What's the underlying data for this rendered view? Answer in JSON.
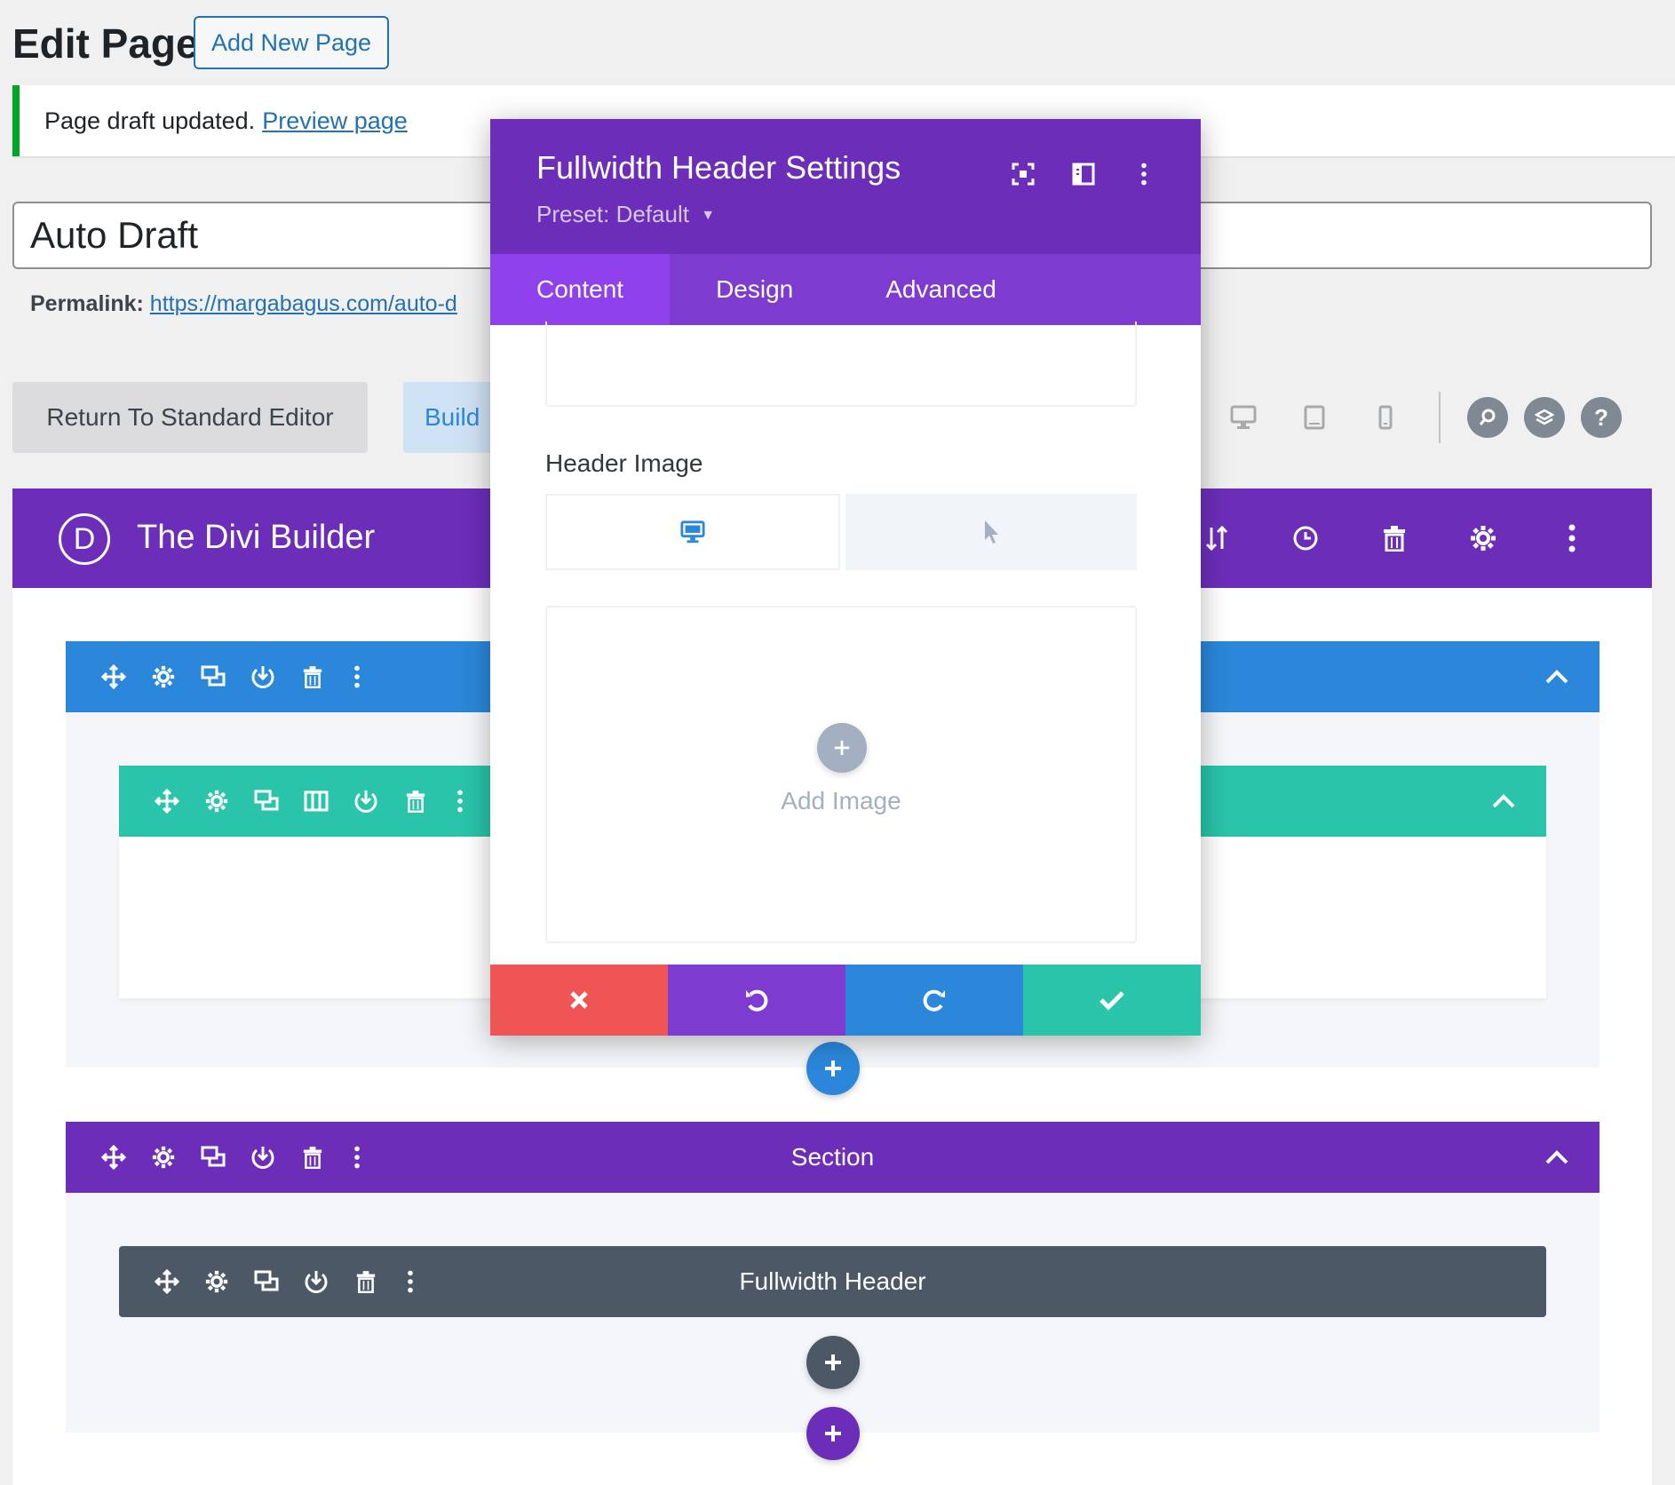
{
  "header": {
    "title": "Edit Page",
    "add_new_label": "Add New Page"
  },
  "notice": {
    "text": "Page draft updated.",
    "link": "Preview page"
  },
  "post": {
    "title": "Auto Draft",
    "permalink_label": "Permalink:",
    "permalink_url": "https://margabagus.com/auto-d"
  },
  "editor": {
    "return_label": "Return To Standard Editor",
    "build_label": "Build",
    "view_icons": [
      "desktop-icon",
      "tablet-icon",
      "phone-icon"
    ],
    "help_icons": [
      "search-icon",
      "layers-icon",
      "help-icon"
    ]
  },
  "builder": {
    "logo_letter": "D",
    "title": "The Divi Builder",
    "actions": [
      "sort-icon",
      "history-icon",
      "trash-icon",
      "gear-icon",
      "more-icon"
    ]
  },
  "modal": {
    "title": "Fullwidth Header Settings",
    "preset": "Preset: Default",
    "tabs": [
      "Content",
      "Design",
      "Advanced"
    ],
    "active_tab": "Content",
    "header_image_label": "Header Image",
    "add_image_label": "Add Image",
    "footer_buttons": [
      "cancel-icon",
      "undo-icon",
      "redo-icon",
      "save-icon"
    ]
  },
  "layout": {
    "section2_label": "Section",
    "module_label": "Fullwidth Header"
  },
  "colors": {
    "divi_purple": "#6c2eb9",
    "section_blue": "#2b87da",
    "row_green": "#29c4a9",
    "module_gray": "#4c5866",
    "cancel_red": "#ef5555",
    "notice_green": "#00a32a"
  }
}
